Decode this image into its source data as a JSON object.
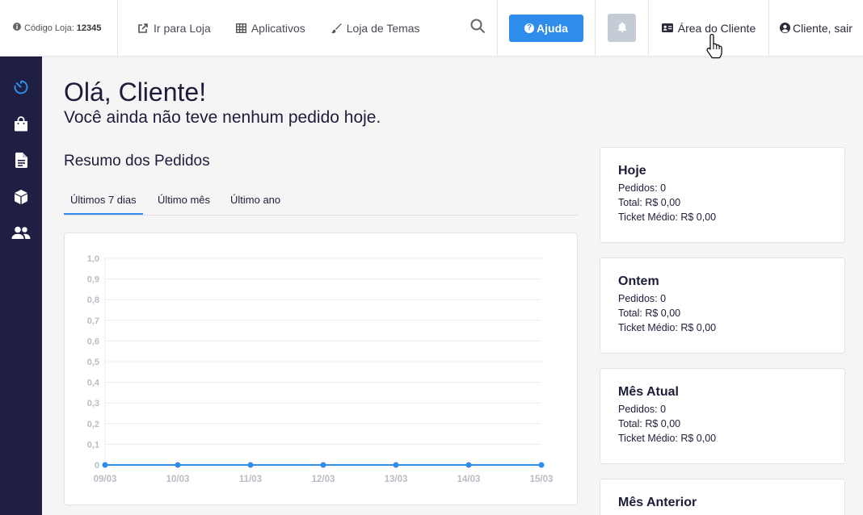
{
  "topbar": {
    "store_code_label": "Código Loja:",
    "store_code": "12345",
    "links": [
      {
        "label": "Ir para Loja",
        "icon": "external-link-icon"
      },
      {
        "label": "Aplicativos",
        "icon": "grid-icon"
      },
      {
        "label": "Loja de Temas",
        "icon": "brush-icon"
      }
    ],
    "help_label": "Ajuda",
    "client_area_label": "Área do Cliente",
    "logout_label": "Cliente, sair"
  },
  "sidebar": {
    "items": [
      {
        "icon": "dashboard-timer-icon",
        "active": true
      },
      {
        "icon": "shopping-bag-icon",
        "active": false
      },
      {
        "icon": "document-icon",
        "active": false
      },
      {
        "icon": "box-icon",
        "active": false
      },
      {
        "icon": "users-icon",
        "active": false
      }
    ]
  },
  "main": {
    "greeting": "Olá, Cliente!",
    "subtitle": "Você ainda não teve nenhum pedido hoje.",
    "summary_title": "Resumo dos Pedidos",
    "tabs": [
      "Últimos 7 dias",
      "Último mês",
      "Último ano"
    ]
  },
  "chart_data": {
    "type": "line",
    "x": [
      "09/03",
      "10/03",
      "11/03",
      "12/03",
      "13/03",
      "14/03",
      "15/03"
    ],
    "series": [
      {
        "values": [
          0,
          0,
          0,
          0,
          0,
          0,
          0
        ]
      }
    ],
    "ylim": [
      0,
      1
    ],
    "yticks": [
      "0",
      "0,1",
      "0,2",
      "0,3",
      "0,4",
      "0,5",
      "0,6",
      "0,7",
      "0,8",
      "0,9",
      "1,0"
    ],
    "grid": true,
    "color": "#2e8ceb"
  },
  "stats": [
    {
      "title": "Hoje",
      "orders": "Pedidos: 0",
      "total": "Total: R$ 0,00",
      "ticket": "Ticket Médio: R$ 0,00"
    },
    {
      "title": "Ontem",
      "orders": "Pedidos: 0",
      "total": "Total: R$ 0,00",
      "ticket": "Ticket Médio: R$ 0,00"
    },
    {
      "title": "Mês Atual",
      "orders": "Pedidos: 0",
      "total": "Total: R$ 0,00",
      "ticket": "Ticket Médio: R$ 0,00"
    },
    {
      "title": "Mês Anterior"
    }
  ]
}
